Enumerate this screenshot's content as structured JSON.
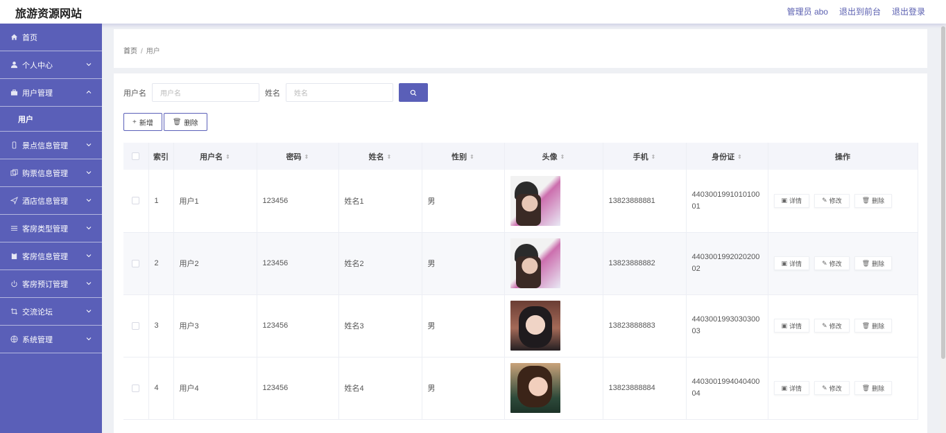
{
  "header": {
    "site_title": "旅游资源网站",
    "admin_label": "管理员 abo",
    "back_label": "退出到前台",
    "logout_label": "退出登录"
  },
  "sidebar": {
    "items": [
      {
        "label": "首页",
        "icon": "home-icon"
      },
      {
        "label": "个人中心",
        "icon": "user-icon"
      },
      {
        "label": "用户管理",
        "icon": "briefcase-icon",
        "expanded": true
      },
      {
        "label": "景点信息管理",
        "icon": "phone-icon"
      },
      {
        "label": "购票信息管理",
        "icon": "copy-icon"
      },
      {
        "label": "酒店信息管理",
        "icon": "send-icon"
      },
      {
        "label": "客房类型管理",
        "icon": "menu-icon"
      },
      {
        "label": "客房信息管理",
        "icon": "clipboard-icon"
      },
      {
        "label": "客房预订管理",
        "icon": "power-icon"
      },
      {
        "label": "交流论坛",
        "icon": "crop-icon"
      },
      {
        "label": "系统管理",
        "icon": "globe-icon"
      }
    ],
    "subitem": "用户"
  },
  "breadcrumb": {
    "home": "首页",
    "sep": "/",
    "current": "用户"
  },
  "search": {
    "username_label": "用户名",
    "username_placeholder": "用户名",
    "name_label": "姓名",
    "name_placeholder": "姓名"
  },
  "actions": {
    "add": "新增",
    "delete": "删除"
  },
  "table": {
    "headers": [
      "索引",
      "用户名",
      "密码",
      "姓名",
      "性别",
      "头像",
      "手机",
      "身份证",
      "操作"
    ],
    "row_actions": {
      "detail": "详情",
      "edit": "修改",
      "delete": "删除"
    },
    "rows": [
      {
        "index": "1",
        "username": "用户1",
        "password": "123456",
        "name": "姓名1",
        "gender": "男",
        "avatar": "av1",
        "phone": "13823888881",
        "idcard": "440300199101010001"
      },
      {
        "index": "2",
        "username": "用户2",
        "password": "123456",
        "name": "姓名2",
        "gender": "男",
        "avatar": "av1",
        "phone": "13823888882",
        "idcard": "440300199202020002"
      },
      {
        "index": "3",
        "username": "用户3",
        "password": "123456",
        "name": "姓名3",
        "gender": "男",
        "avatar": "av3",
        "phone": "13823888883",
        "idcard": "440300199303030003"
      },
      {
        "index": "4",
        "username": "用户4",
        "password": "123456",
        "name": "姓名4",
        "gender": "男",
        "avatar": "av4",
        "phone": "13823888884",
        "idcard": "440300199404040004"
      }
    ]
  },
  "colors": {
    "accent": "#5a5fb8",
    "sidebar_bg": "#5a5fb8",
    "page_bg": "#eef0f4"
  }
}
